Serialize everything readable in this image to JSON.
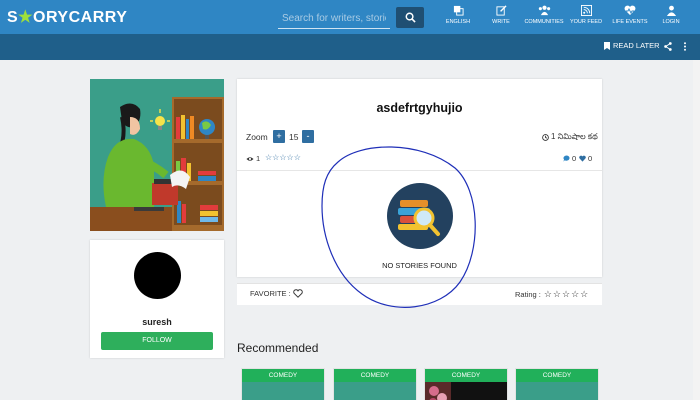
{
  "header": {
    "logo_left": "S",
    "logo_accent": "★",
    "logo_rest": "ORYCARRY",
    "search_placeholder": "Search for writers, stories, ...",
    "nav": [
      {
        "label": "ENGLISH",
        "icon": "translate-icon"
      },
      {
        "label": "WRITE",
        "icon": "write-icon"
      },
      {
        "label": "COMMUNITIES",
        "icon": "communities-icon"
      },
      {
        "label": "YOUR FEED",
        "icon": "rss-feed-icon"
      },
      {
        "label": "LIFE EVENTS",
        "icon": "life-events-icon"
      },
      {
        "label": "LOGIN",
        "icon": "user-icon"
      }
    ],
    "read_later": "READ LATER"
  },
  "author": {
    "name": "suresh",
    "follow_label": "FOLLOW"
  },
  "story": {
    "title": "asdefrtgyhujio",
    "zoom_label": "Zoom",
    "zoom_value": "15",
    "read_time": "1 నిమిషాల కథ",
    "views": "1",
    "comments": "0",
    "likes": "0",
    "empty_label": "NO STORIES FOUND"
  },
  "rating_bar": {
    "favorite_label": "FAVORITE :",
    "rating_label": "Rating :",
    "rating_stars": "☆☆☆☆☆"
  },
  "recommended": {
    "heading": "Recommended",
    "cards": [
      {
        "category": "COMEDY"
      },
      {
        "category": "COMEDY"
      },
      {
        "category": "COMEDY"
      },
      {
        "category": "COMEDY"
      }
    ]
  },
  "colors": {
    "topbar": "#2f86c4",
    "subbar": "#1f5f8a",
    "green": "#2eaf5c",
    "zoom_button": "#2f6ea1"
  }
}
